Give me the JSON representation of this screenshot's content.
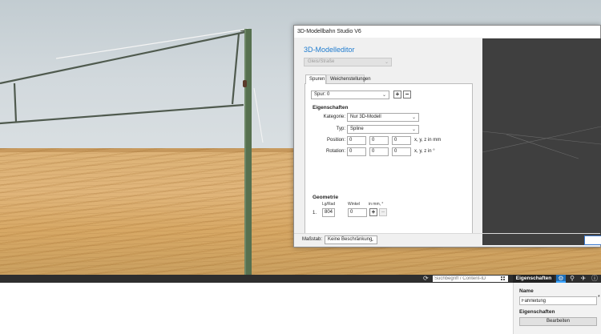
{
  "dialog": {
    "title": "3D-Modellbahn Studio V6",
    "heading": "3D-Modelleditor",
    "category_select": "Gleis/Straße",
    "tabs": [
      "Spuren",
      "Weichenstellungen"
    ],
    "track_select": "Spur: 0",
    "properties_header": "Eigenschaften",
    "kategorie_label": "Kategorie:",
    "kategorie_value": "Nur 3D-Modell",
    "typ_label": "Typ:",
    "typ_value": "Spline",
    "position_label": "Position:",
    "position_values": [
      "0",
      "0",
      "0"
    ],
    "position_unit": "x, y, z in mm",
    "rotation_label": "Rotation:",
    "rotation_values": [
      "0",
      "0",
      "0"
    ],
    "rotation_unit": "x, y, z in °",
    "geometry_header": "Geometrie",
    "geo_col_length": "Lg/Rad",
    "geo_col_angle": "Winkel",
    "geo_col_unit": "in mm, °",
    "geo_row_index": "1.",
    "geo_row_length": "804",
    "geo_row_angle": "0",
    "scale_label": "Maßstab:",
    "scale_value": "Keine Beschränkung"
  },
  "toolbar": {
    "search_placeholder": "Suchbegriff / Content-ID",
    "properties_tab": "Eigenschaften"
  },
  "properties": {
    "name_label": "Name",
    "name_value": "Fahrleitung",
    "name_modified_marker": "*",
    "section_label": "Eigenschaften",
    "edit_button": "Bearbeiten"
  },
  "icons": [
    "refresh-icon",
    "grid-icon",
    "gear-icon",
    "share-icon",
    "rocket-icon",
    "info-icon",
    "chevron-down-icon",
    "plus-icon",
    "minus-icon"
  ],
  "colors": {
    "accent": "#1f7ccf",
    "bar": "#2e2e2e",
    "preview": "#3f3f3f",
    "pole": "#56704f"
  }
}
